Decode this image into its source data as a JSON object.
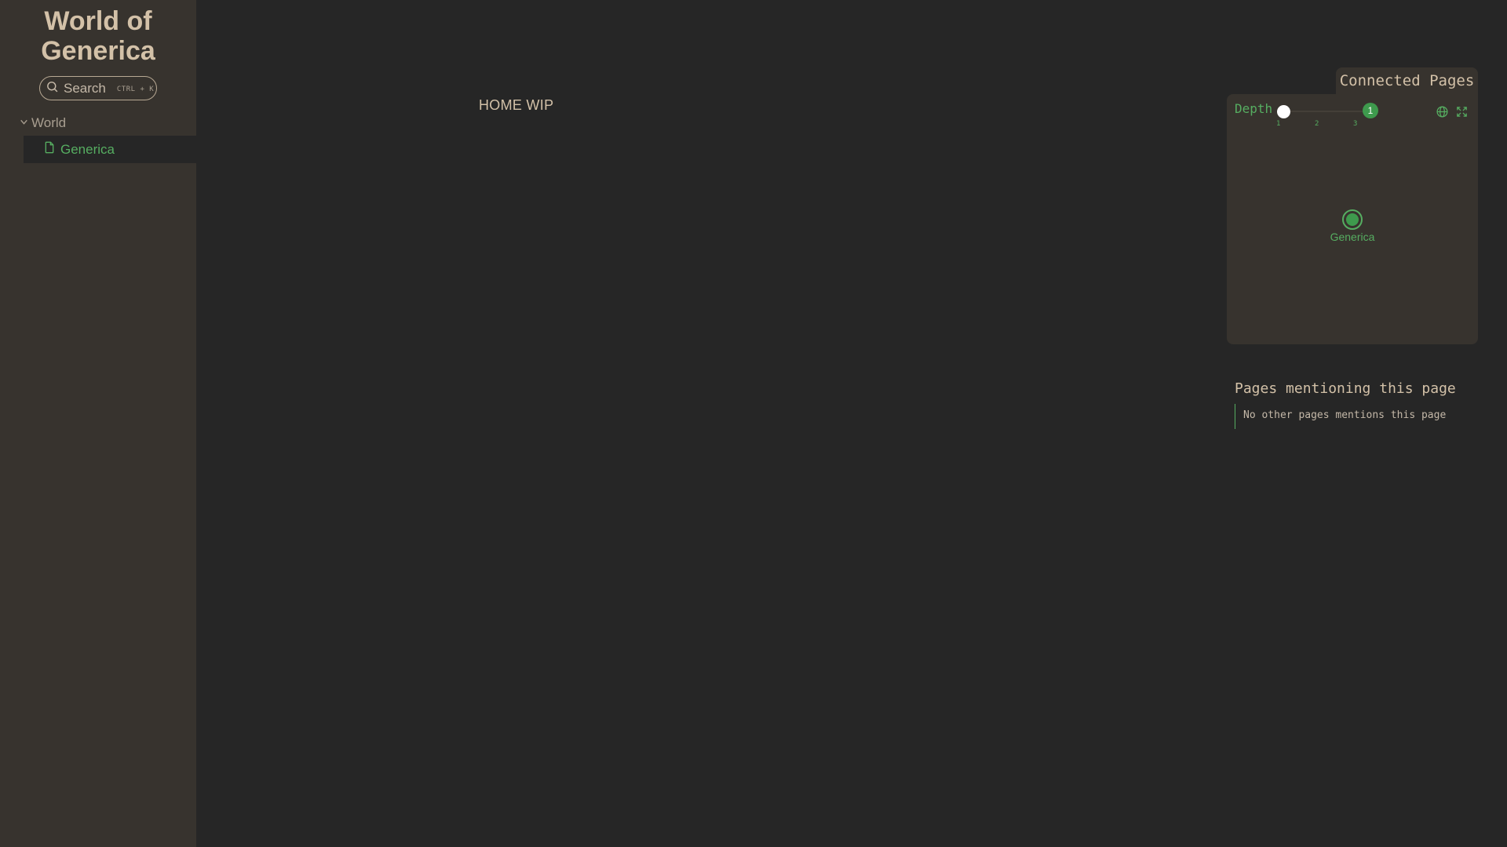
{
  "sidebar": {
    "site_title_line1": "World of",
    "site_title_line2": "Generica",
    "search": {
      "label": "Search",
      "shortcut": "CTRL + K",
      "icon": "search-icon"
    },
    "tree": {
      "folder_label": "World",
      "folder_icon": "chevron-down-icon",
      "expanded": true,
      "pages": [
        {
          "label": "Generica",
          "icon": "file-icon",
          "active": true
        }
      ]
    }
  },
  "main": {
    "body_text": "HOME WIP"
  },
  "connected_pages": {
    "title": "Connected Pages",
    "depth_label": "Depth",
    "depth_value": "1",
    "depth_ticks": [
      "1",
      "2",
      "3"
    ],
    "buttons": {
      "global_view_icon": "globe-icon",
      "fullscreen_icon": "expand-icon"
    },
    "graph": {
      "nodes": [
        {
          "label": "Generica",
          "current": true
        }
      ]
    }
  },
  "mentions": {
    "title": "Pages mentioning this page",
    "empty_text": "No other pages mentions this page"
  },
  "colors": {
    "background": "#262626",
    "sidebar": "#37332e",
    "accent_green": "#56ad61",
    "text_beige": "#d3c1a8"
  }
}
